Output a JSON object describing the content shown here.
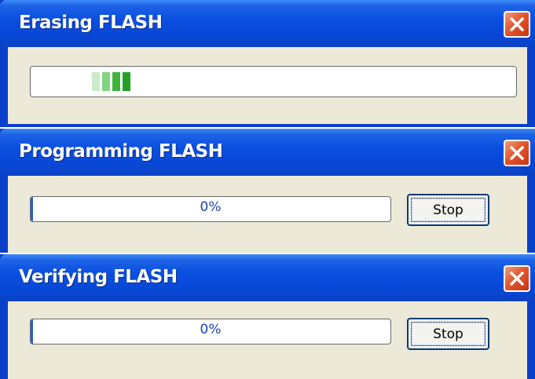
{
  "windows": [
    {
      "title": "Erasing FLASH",
      "progress_style": "marquee"
    },
    {
      "title": "Programming FLASH",
      "progress_text": "0%",
      "stop_label": "Stop"
    },
    {
      "title": "Verifying FLASH",
      "progress_text": "0%",
      "stop_label": "Stop"
    }
  ],
  "icons": {
    "close": "close-icon"
  },
  "colors": {
    "titlebar": "#0a4fe0",
    "client_bg": "#ece9d8",
    "close_button": "#e2572f",
    "progress_text": "#1a44b8",
    "marquee_green": "#3cb43c"
  }
}
